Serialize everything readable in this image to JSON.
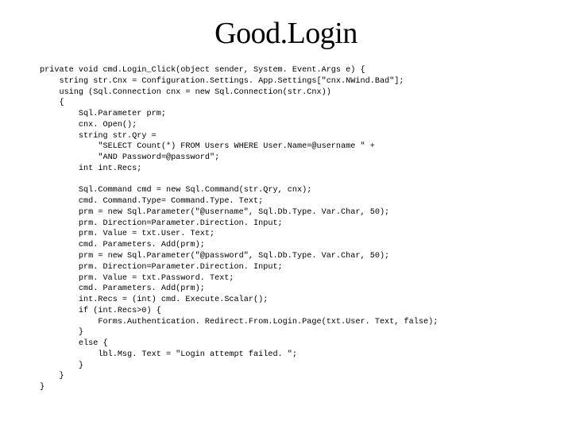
{
  "title": "Good.Login",
  "code": "private void cmd.Login_Click(object sender, System. Event.Args e) {\n    string str.Cnx = Configuration.Settings. App.Settings[\"cnx.NWind.Bad\"];\n    using (Sql.Connection cnx = new Sql.Connection(str.Cnx))\n    {\n        Sql.Parameter prm;\n        cnx. Open();\n        string str.Qry =\n            \"SELECT Count(*) FROM Users WHERE User.Name=@username \" +\n            \"AND Password=@password\";\n        int int.Recs;\n\n        Sql.Command cmd = new Sql.Command(str.Qry, cnx);\n        cmd. Command.Type= Command.Type. Text;\n        prm = new Sql.Parameter(\"@username\", Sql.Db.Type. Var.Char, 50);\n        prm. Direction=Parameter.Direction. Input;\n        prm. Value = txt.User. Text;\n        cmd. Parameters. Add(prm);\n        prm = new Sql.Parameter(\"@password\", Sql.Db.Type. Var.Char, 50);\n        prm. Direction=Parameter.Direction. Input;\n        prm. Value = txt.Password. Text;\n        cmd. Parameters. Add(prm);\n        int.Recs = (int) cmd. Execute.Scalar();\n        if (int.Recs>0) {\n            Forms.Authentication. Redirect.From.Login.Page(txt.User. Text, false);\n        }\n        else {\n            lbl.Msg. Text = \"Login attempt failed. \";\n        }\n    }\n}"
}
